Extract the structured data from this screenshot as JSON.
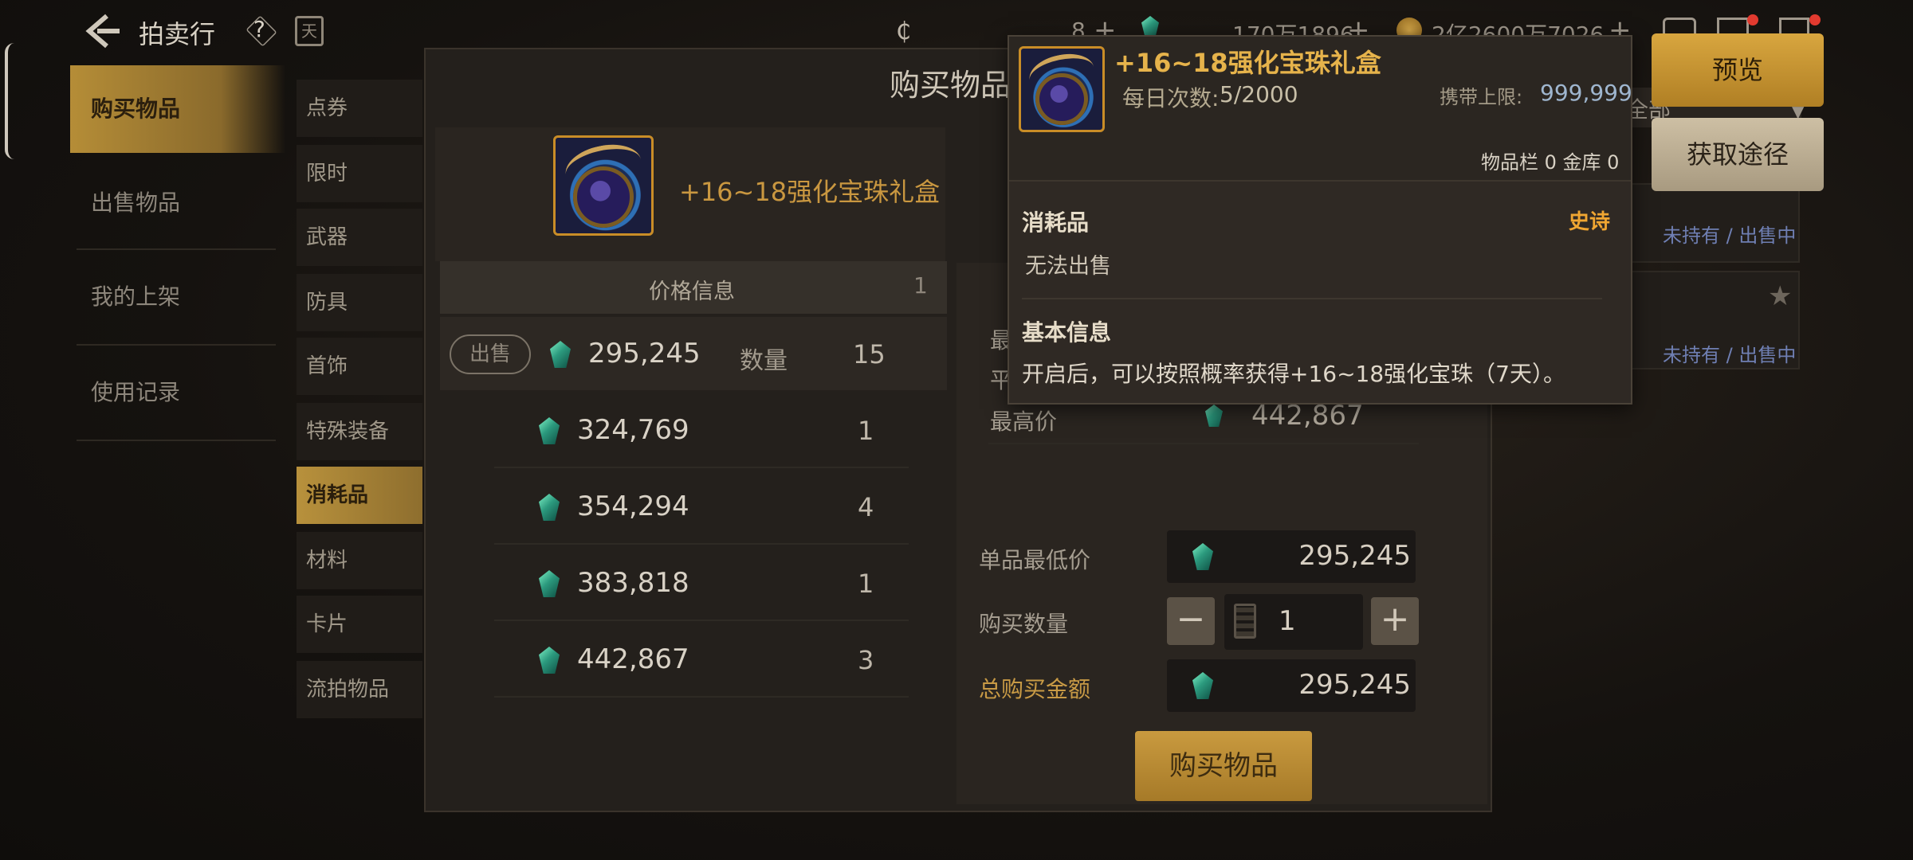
{
  "header": {
    "title": "拍卖行",
    "help_icon": "question-diamond-icon",
    "calendar_label": "天",
    "currency_1_value": "8",
    "currency_2_value": "170万1896",
    "currency_3_value": "2亿2600万7026"
  },
  "nav": {
    "items": [
      {
        "label": "购买物品"
      },
      {
        "label": "出售物品"
      },
      {
        "label": "我的上架"
      },
      {
        "label": "使用记录"
      }
    ]
  },
  "categories": [
    "点券",
    "限时",
    "武器",
    "防具",
    "首饰",
    "特殊装备",
    "消耗品",
    "材料",
    "卡片",
    "流拍物品"
  ],
  "panel": {
    "title": "购买物品",
    "item_name": "+16~18强化宝珠礼盒",
    "price_header": "价格信息",
    "price_header_count": "1",
    "sell_button": "出售",
    "qty_label": "数量",
    "rows": [
      {
        "price": "295,245",
        "qty": "15"
      },
      {
        "price": "324,769",
        "qty": "1"
      },
      {
        "price": "354,294",
        "qty": "4"
      },
      {
        "price": "383,818",
        "qty": "1"
      },
      {
        "price": "442,867",
        "qty": "3"
      }
    ]
  },
  "purchase": {
    "partial_label_1": "最",
    "partial_label_2": "平",
    "max_price_label": "最高价",
    "max_price": "442,867",
    "unit_min_label": "单品最低价",
    "unit_min_value": "295,245",
    "buy_qty_label": "购买数量",
    "buy_qty_value": "1",
    "minus": "−",
    "plus": "+",
    "total_label": "总购买金额",
    "total_value": "295,245",
    "buy_button": "购买物品"
  },
  "right_list": {
    "filter_partial": "全部",
    "row1_status": "未持有 / 出售中",
    "row2_status": "未持有 / 出售中"
  },
  "tooltip": {
    "title": "+16~18强化宝珠礼盒",
    "daily_label": "每日次数:",
    "daily_value": "5/2000",
    "carry_label": "携带上限:",
    "carry_value": "999,999",
    "storage": "物品栏 0 金库 0",
    "category": "消耗品",
    "rarity": "史诗",
    "unsellable": "无法出售",
    "basic_info": "基本信息",
    "description": "开启后，可以按照概率获得+16~18强化宝珠（7天）。"
  },
  "side_buttons": {
    "preview": "预览",
    "source": "获取途径"
  },
  "colors": {
    "accent_gold": "#b58d37",
    "rarity_epic": "#f0a632",
    "gem": "#2c9a7e"
  }
}
